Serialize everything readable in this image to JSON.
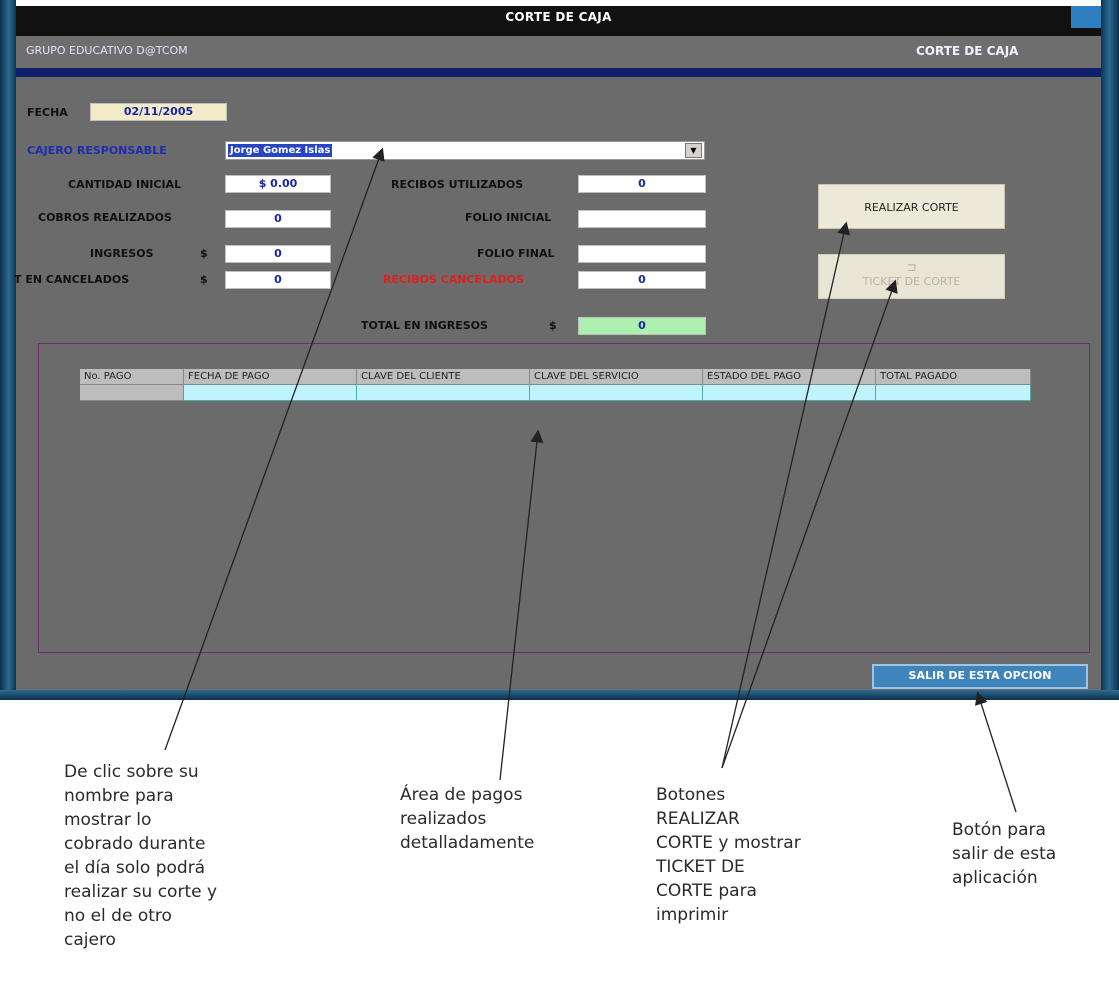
{
  "window": {
    "title": "CORTE DE CAJA",
    "organization": "GRUPO EDUCATIVO D@TCOM",
    "module_title": "CORTE DE CAJA"
  },
  "form": {
    "fecha_label": "FECHA",
    "fecha_value": "02/11/2005",
    "cajero_label": "CAJERO RESPONSABLE",
    "cajero_value": "Jorge Gomez Islas",
    "cantidad_inicial_label": "CANTIDAD INICIAL",
    "cantidad_inicial_value": "$ 0.00",
    "cobros_realizados_label": "COBROS REALIZADOS",
    "cobros_realizados_value": "0",
    "ingresos_label": "INGRESOS",
    "ingresos_currency": "$",
    "ingresos_value": "0",
    "t_cancelados_label": "T EN CANCELADOS",
    "t_cancelados_currency": "$",
    "t_cancelados_value": "0",
    "recibos_utilizados_label": "RECIBOS UTILIZADOS",
    "recibos_utilizados_value": "0",
    "folio_inicial_label": "FOLIO INICIAL",
    "folio_inicial_value": "",
    "folio_final_label": "FOLIO FINAL",
    "folio_final_value": "",
    "recibos_cancelados_label": "RECIBOS CANCELADOS",
    "recibos_cancelados_value": "0",
    "total_ingresos_label": "TOTAL EN INGRESOS",
    "total_ingresos_currency": "$",
    "total_ingresos_value": "0"
  },
  "buttons": {
    "realizar_corte": "REALIZAR CORTE",
    "ticket_corte": "TICKET DE CORTE",
    "salir": "SALIR DE ESTA OPCION"
  },
  "grid": {
    "columns": [
      "No. PAGO",
      "FECHA DE PAGO",
      "CLAVE DEL CLIENTE",
      "CLAVE DEL SERVICIO",
      "ESTADO DEL PAGO",
      "TOTAL PAGADO"
    ]
  },
  "annotations": {
    "cajero_note": "De clic sobre su\nnombre para\nmostrar lo\ncobrado durante\nel día solo podrá\nrealizar su corte y\nno el de otro\ncajero",
    "grid_note": "Área de pagos\nrealizados\ndetalladamente",
    "buttons_note": "Botones\nREALIZAR\nCORTE y mostrar\nTICKET DE\nCORTE para\nimprimir",
    "exit_note": "Botón para\nsalir de esta\naplicación"
  },
  "colors": {
    "client_bg": "#6b6b6b",
    "blue_band": "#0f1f6b",
    "grid_cell": "#bff4ff",
    "total_field": "#aef0b0",
    "red_label": "#e31e1e"
  }
}
